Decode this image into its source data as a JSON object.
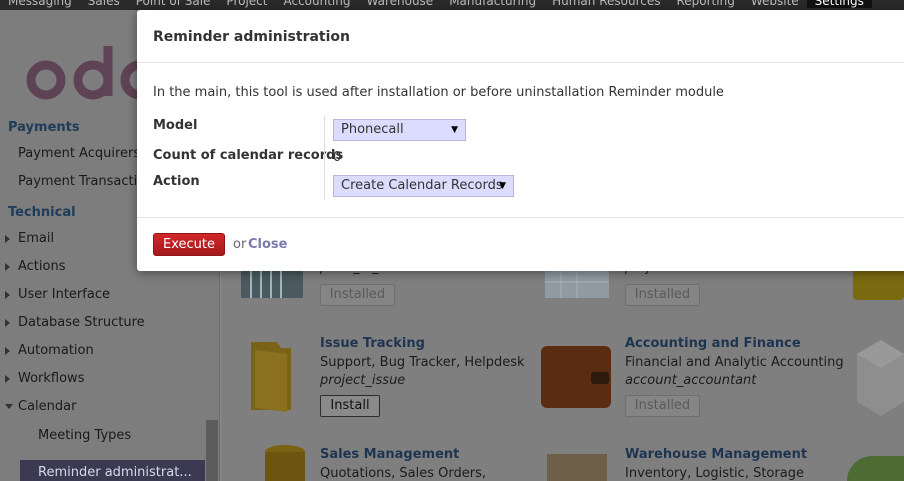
{
  "topbar": {
    "menu": [
      "Messaging",
      "Sales",
      "Point of Sale",
      "Project",
      "Accounting",
      "Warehouse",
      "Manufacturing",
      "Human Resources",
      "Reporting",
      "Website",
      "Settings"
    ]
  },
  "sidebar": {
    "logo_text": "odoo",
    "sections": [
      {
        "title": "Payments",
        "items": [
          "Payment Acquirers",
          "Payment Transactions"
        ]
      },
      {
        "title": "Technical",
        "items": [
          "Email",
          "Actions",
          "User Interface",
          "Database Structure",
          "Automation",
          "Workflows",
          "Calendar"
        ]
      }
    ],
    "calendar_children": [
      "Meeting Types"
    ],
    "selected": "Reminder administrat..."
  },
  "apps": {
    "top_left_tech": "point_of_sale",
    "top_left_status": "Installed",
    "top_mid_tech": "project",
    "top_mid_status": "Installed",
    "issue": {
      "title": "Issue Tracking",
      "summary": "Support, Bug Tracker, Helpdesk",
      "tech": "project_issue",
      "button": "Install"
    },
    "accounting": {
      "title": "Accounting and Finance",
      "summary": "Financial and Analytic Accounting",
      "tech": "account_accountant",
      "button": "Installed"
    },
    "sales": {
      "title": "Sales Management",
      "summary": "Quotations, Sales Orders,"
    },
    "warehouse": {
      "title": "Warehouse Management",
      "summary": "Inventory, Logistic, Storage"
    }
  },
  "modal": {
    "title": "Reminder administration",
    "intro": "In the main, this tool is used after installation or before uninstallation Reminder module",
    "model_label": "Model",
    "model_value": "Phonecall",
    "count_label": "Count of calendar records",
    "count_value": "0",
    "action_label": "Action",
    "action_value": "Create Calendar Records",
    "execute_label": "Execute",
    "or_text": "or",
    "close_label": "Close"
  },
  "colors": {
    "brand": "#875a7b",
    "execute": "#c3232a",
    "select_bg": "#dcdcff",
    "link": "#7c7bad"
  }
}
